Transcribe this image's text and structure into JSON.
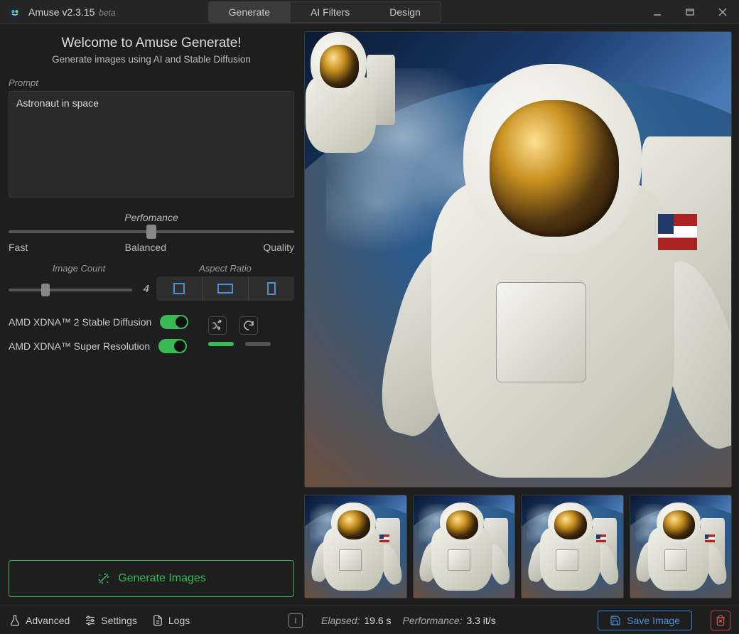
{
  "app": {
    "name": "Amuse",
    "version": "v2.3.15",
    "beta_tag": "beta"
  },
  "tabs": [
    "Generate",
    "AI Filters",
    "Design"
  ],
  "active_tab": 0,
  "welcome": {
    "title": "Welcome to Amuse Generate!",
    "subtitle": "Generate images using AI and Stable Diffusion"
  },
  "prompt": {
    "label": "Prompt",
    "value": "Astronaut in space"
  },
  "performance": {
    "label": "Perfomance",
    "left": "Fast",
    "mid": "Balanced",
    "right": "Quality",
    "position_pct": 50
  },
  "image_count": {
    "label": "Image Count",
    "value": "4",
    "position_pct": 30
  },
  "aspect_ratio": {
    "label": "Aspect Ratio"
  },
  "toggles": {
    "stable_diffusion": {
      "label": "AMD XDNA™ 2 Stable Diffusion",
      "on": true
    },
    "super_resolution": {
      "label": "AMD XDNA™ Super Resolution",
      "on": true
    }
  },
  "generate_button": "Generate Images",
  "footer": {
    "advanced": "Advanced",
    "settings": "Settings",
    "logs": "Logs",
    "elapsed_label": "Elapsed:",
    "elapsed_value": "19.6 s",
    "perf_label": "Performance:",
    "perf_value": "3.3 it/s",
    "save": "Save Image"
  }
}
